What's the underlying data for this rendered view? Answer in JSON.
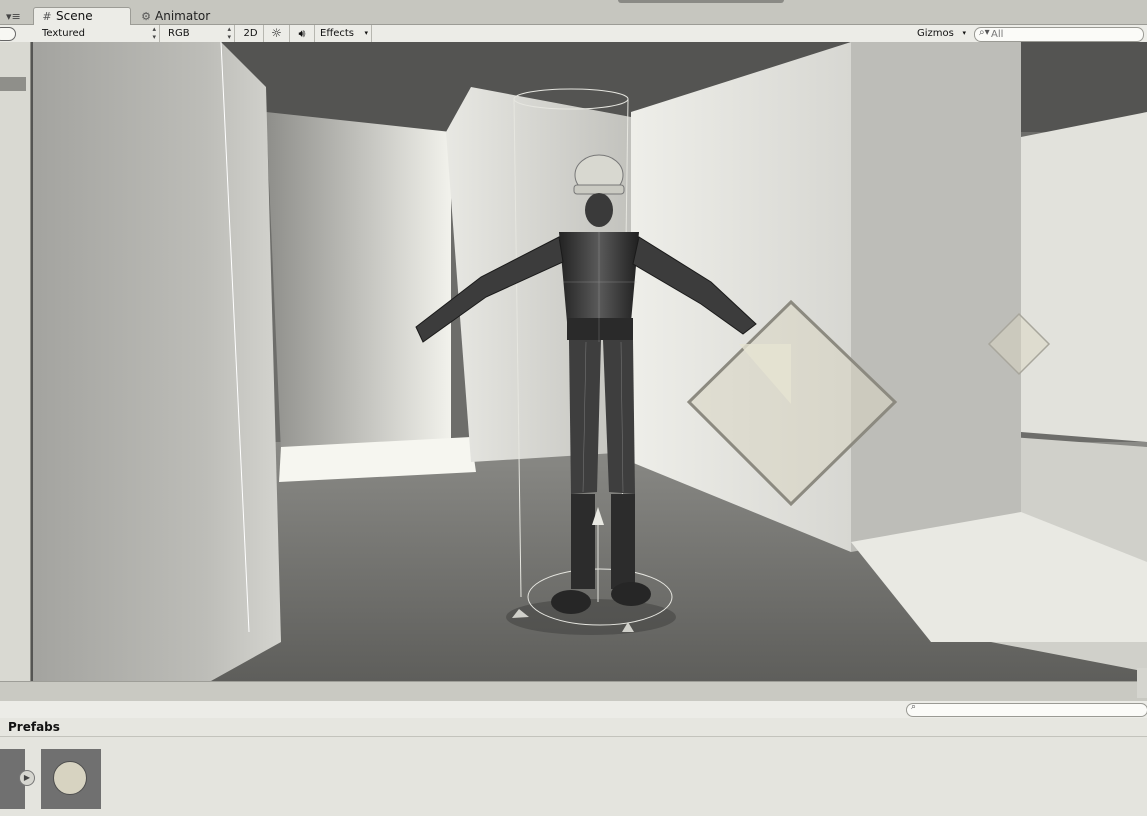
{
  "tabs": [
    {
      "label": "Scene",
      "icon": "grid-icon",
      "active": true
    },
    {
      "label": "Animator",
      "icon": "animator-icon",
      "active": false
    }
  ],
  "toolbar": {
    "draw_mode": "Textured",
    "render_mode": "RGB",
    "toggle_2d": "2D",
    "lighting_icon": "sun-icon",
    "audio_icon": "speaker-icon",
    "effects": "Effects",
    "gizmos": "Gizmos",
    "search_placeholder": "All"
  },
  "project": {
    "folder_title": "Prefabs",
    "search_placeholder": ""
  },
  "colors": {
    "chrome": "#dcdcd6",
    "toolbar": "#ecece7",
    "viewport_floor": "#6d6d6a",
    "gizmo": "#d9d6c2"
  }
}
